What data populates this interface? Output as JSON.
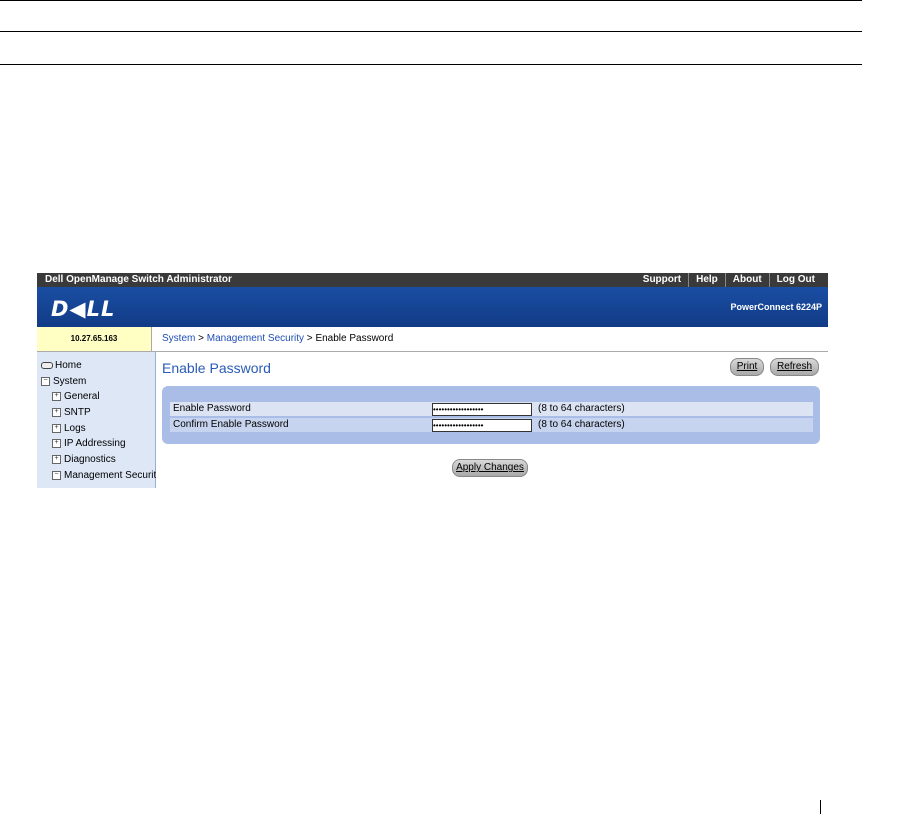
{
  "app": {
    "title": "Dell OpenManage Switch Administrator",
    "top_links": [
      "Support",
      "Help",
      "About",
      "Log Out"
    ],
    "logo_text": "D◀LL",
    "model": "PowerConnect 6224P",
    "ip_address": "10.27.65.163"
  },
  "breadcrumb": {
    "system": "System",
    "sep1": " > ",
    "management_security": "Management Security",
    "sep2": " > ",
    "current": "Enable Password"
  },
  "sidebar": {
    "items": [
      {
        "label": "Home",
        "icon": "home-icon",
        "expander": ""
      },
      {
        "label": "System",
        "icon": "",
        "expander": "−"
      },
      {
        "label": "General",
        "icon": "",
        "expander": "+"
      },
      {
        "label": "SNTP",
        "icon": "",
        "expander": "+"
      },
      {
        "label": "Logs",
        "icon": "",
        "expander": "+"
      },
      {
        "label": "IP Addressing",
        "icon": "",
        "expander": "+"
      },
      {
        "label": "Diagnostics",
        "icon": "",
        "expander": "+"
      },
      {
        "label": "Management Security",
        "icon": "",
        "expander": "−"
      }
    ]
  },
  "main": {
    "title": "Enable Password",
    "print_label": "Print",
    "refresh_label": "Refresh",
    "fields": [
      {
        "label": "Enable Password",
        "value": "••••••••••••••••••",
        "hint": "(8 to 64 characters)"
      },
      {
        "label": "Confirm Enable Password",
        "value": "••••••••••••••••••",
        "hint": "(8 to 64 characters)"
      }
    ],
    "apply_label": "Apply Changes"
  },
  "colors": {
    "topbar": "#3a3a3a",
    "brand_blue": "#113b86",
    "ip_box": "#ffffc4",
    "sidebar": "#dde7f6",
    "form_panel": "#a9bde6",
    "link_blue": "#1f4fb5"
  }
}
